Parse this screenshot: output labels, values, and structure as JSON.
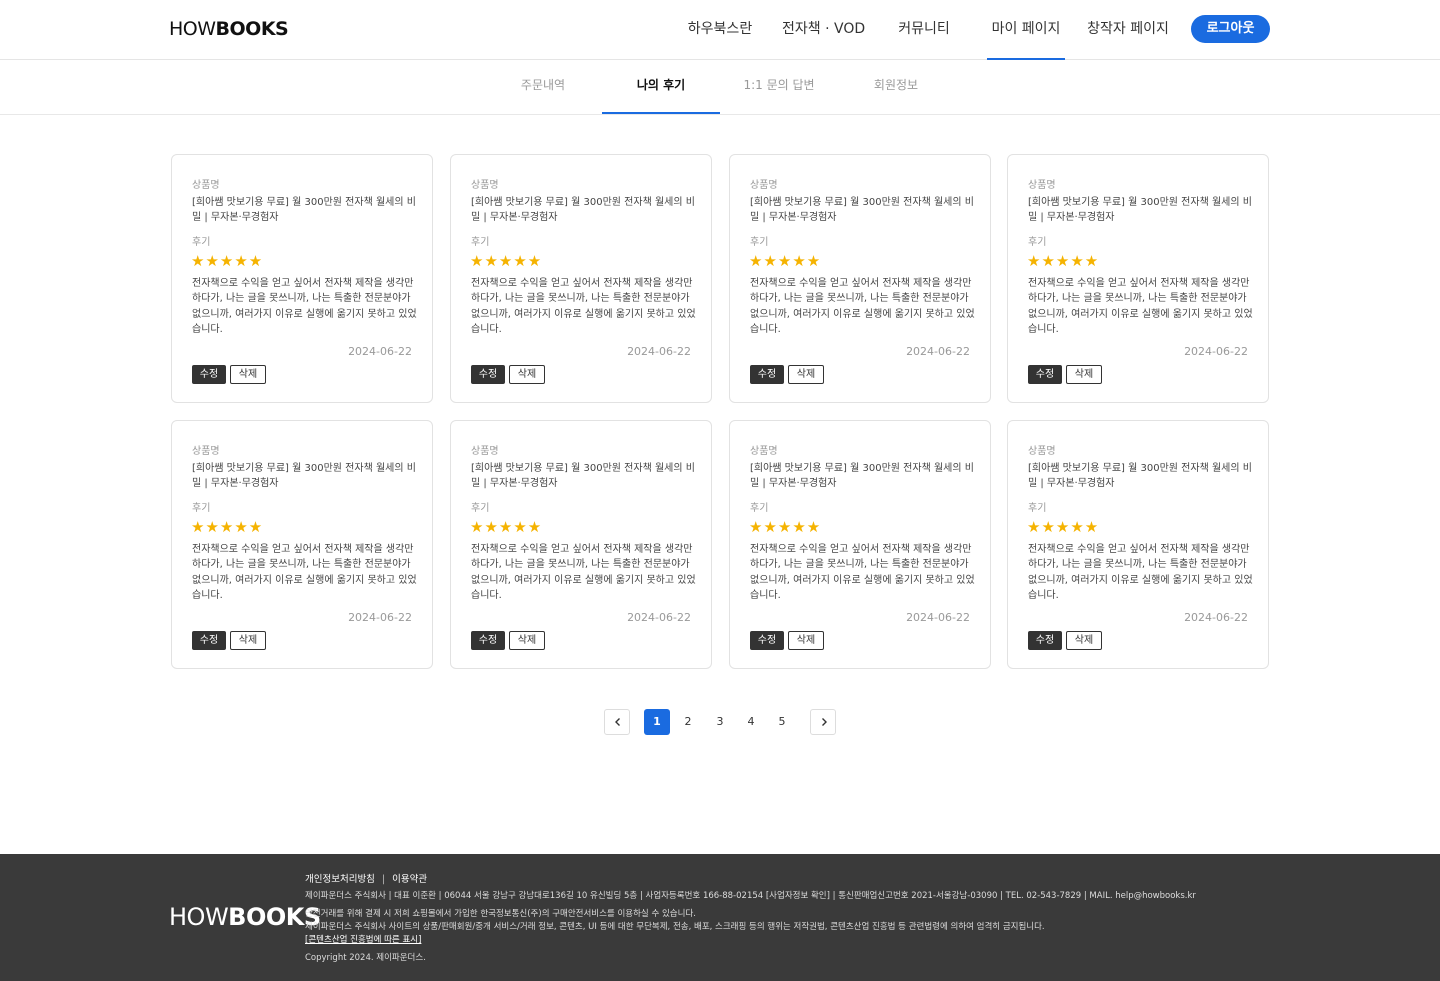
{
  "header": {
    "logo_part1": "HOW",
    "logo_part2": "BOOKS",
    "nav": [
      {
        "label": "하우북스란"
      },
      {
        "label": "전자책 · VOD"
      },
      {
        "label": "커뮤니티"
      },
      {
        "label": "마이 페이지",
        "active": true
      },
      {
        "label": "창작자 페이지"
      }
    ],
    "logout_label": "로그아웃"
  },
  "subnav": {
    "tabs": [
      {
        "label": "주문내역"
      },
      {
        "label": "나의 후기",
        "active": true
      },
      {
        "label": "1:1 문의 답변"
      },
      {
        "label": "회원정보"
      }
    ]
  },
  "reviews": [
    {
      "product_label": "상품명",
      "product": "[희아쌤 맛보기용 무료] 월 300만원 전자책 월세의 비밀 | 무자본·무경험자",
      "review_label": "후기",
      "rating": 5,
      "stars": "★★★★★",
      "text": "전자책으로 수익을 얻고 싶어서 전자책 제작을 생각만 하다가, 나는 글을 못쓰니까, 나는 특출한 전문분야가 없으니까, 여러가지 이유로 실행에 옮기지 못하고 있었습니다.",
      "date": "2024-06-22",
      "edit": "수정",
      "delete": "삭제"
    },
    {
      "product_label": "상품명",
      "product": "[희아쌤 맛보기용 무료] 월 300만원 전자책 월세의 비밀 | 무자본·무경험자",
      "review_label": "후기",
      "rating": 5,
      "stars": "★★★★★",
      "text": "전자책으로 수익을 얻고 싶어서 전자책 제작을 생각만 하다가, 나는 글을 못쓰니까, 나는 특출한 전문분야가 없으니까, 여러가지 이유로 실행에 옮기지 못하고 있었습니다.",
      "date": "2024-06-22",
      "edit": "수정",
      "delete": "삭제"
    },
    {
      "product_label": "상품명",
      "product": "[희아쌤 맛보기용 무료] 월 300만원 전자책 월세의 비밀 | 무자본·무경험자",
      "review_label": "후기",
      "rating": 5,
      "stars": "★★★★★",
      "text": "전자책으로 수익을 얻고 싶어서 전자책 제작을 생각만 하다가, 나는 글을 못쓰니까, 나는 특출한 전문분야가 없으니까, 여러가지 이유로 실행에 옮기지 못하고 있었습니다.",
      "date": "2024-06-22",
      "edit": "수정",
      "delete": "삭제"
    },
    {
      "product_label": "상품명",
      "product": "[희아쌤 맛보기용 무료] 월 300만원 전자책 월세의 비밀 | 무자본·무경험자",
      "review_label": "후기",
      "rating": 5,
      "stars": "★★★★★",
      "text": "전자책으로 수익을 얻고 싶어서 전자책 제작을 생각만 하다가, 나는 글을 못쓰니까, 나는 특출한 전문분야가 없으니까, 여러가지 이유로 실행에 옮기지 못하고 있었습니다.",
      "date": "2024-06-22",
      "edit": "수정",
      "delete": "삭제"
    },
    {
      "product_label": "상품명",
      "product": "[희아쌤 맛보기용 무료] 월 300만원 전자책 월세의 비밀 | 무자본·무경험자",
      "review_label": "후기",
      "rating": 5,
      "stars": "★★★★★",
      "text": "전자책으로 수익을 얻고 싶어서 전자책 제작을 생각만 하다가, 나는 글을 못쓰니까, 나는 특출한 전문분야가 없으니까, 여러가지 이유로 실행에 옮기지 못하고 있었습니다.",
      "date": "2024-06-22",
      "edit": "수정",
      "delete": "삭제"
    },
    {
      "product_label": "상품명",
      "product": "[희아쌤 맛보기용 무료] 월 300만원 전자책 월세의 비밀 | 무자본·무경험자",
      "review_label": "후기",
      "rating": 5,
      "stars": "★★★★★",
      "text": "전자책으로 수익을 얻고 싶어서 전자책 제작을 생각만 하다가, 나는 글을 못쓰니까, 나는 특출한 전문분야가 없으니까, 여러가지 이유로 실행에 옮기지 못하고 있었습니다.",
      "date": "2024-06-22",
      "edit": "수정",
      "delete": "삭제"
    },
    {
      "product_label": "상품명",
      "product": "[희아쌤 맛보기용 무료] 월 300만원 전자책 월세의 비밀 | 무자본·무경험자",
      "review_label": "후기",
      "rating": 5,
      "stars": "★★★★★",
      "text": "전자책으로 수익을 얻고 싶어서 전자책 제작을 생각만 하다가, 나는 글을 못쓰니까, 나는 특출한 전문분야가 없으니까, 여러가지 이유로 실행에 옮기지 못하고 있었습니다.",
      "date": "2024-06-22",
      "edit": "수정",
      "delete": "삭제"
    },
    {
      "product_label": "상품명",
      "product": "[희아쌤 맛보기용 무료] 월 300만원 전자책 월세의 비밀 | 무자본·무경험자",
      "review_label": "후기",
      "rating": 5,
      "stars": "★★★★★",
      "text": "전자책으로 수익을 얻고 싶어서 전자책 제작을 생각만 하다가, 나는 글을 못쓰니까, 나는 특출한 전문분야가 없으니까, 여러가지 이유로 실행에 옮기지 못하고 있었습니다.",
      "date": "2024-06-22",
      "edit": "수정",
      "delete": "삭제"
    }
  ],
  "pagination": {
    "pages": [
      "1",
      "2",
      "3",
      "4",
      "5"
    ],
    "current": "1",
    "prev_icon": "chevron-left-icon",
    "next_icon": "chevron-right-icon"
  },
  "footer": {
    "logo_part1": "HOW",
    "logo_part2": "BOOKS",
    "links": [
      "개인정보처리방침",
      "이용약관"
    ],
    "company_info": "제이파운더스 주식회사  |  대표 이준환  |  06044 서울 강남구 강남대로136길 10 유신빌딩 5층  |  사업자등록번호 166-88-02154 [사업자정보 확인]  |  통신판매업신고번호 2021-서울강남-03090 | TEL. 02-543-7829 | MAIL. help@howbooks.kr",
    "safety_notice": "안전거래를 위해 결제 시 저희 쇼핑몰에서 가입한 한국정보통신(주)의 구매안전서비스를 이용하실 수 있습니다.",
    "copyright_notice": "제이파운더스 주식회사 사이트의 상품/판매회원/중개 서비스/거래 정보, 콘텐츠, UI 등에 대한 무단복제, 전송, 배포, 스크래핑 등의 행위는 저작권법, 콘텐츠산업 진흥법 등 관련법령에 의하여 엄격히 금지됩니다.",
    "content_law_link": "[콘텐츠산업 진흥법에 따른 표시]",
    "copyright": "Copyright 2024. 제이파운더스."
  },
  "colors": {
    "accent": "#1a6be0",
    "star": "#f5b301",
    "footer_bg": "#3a3a3a"
  }
}
